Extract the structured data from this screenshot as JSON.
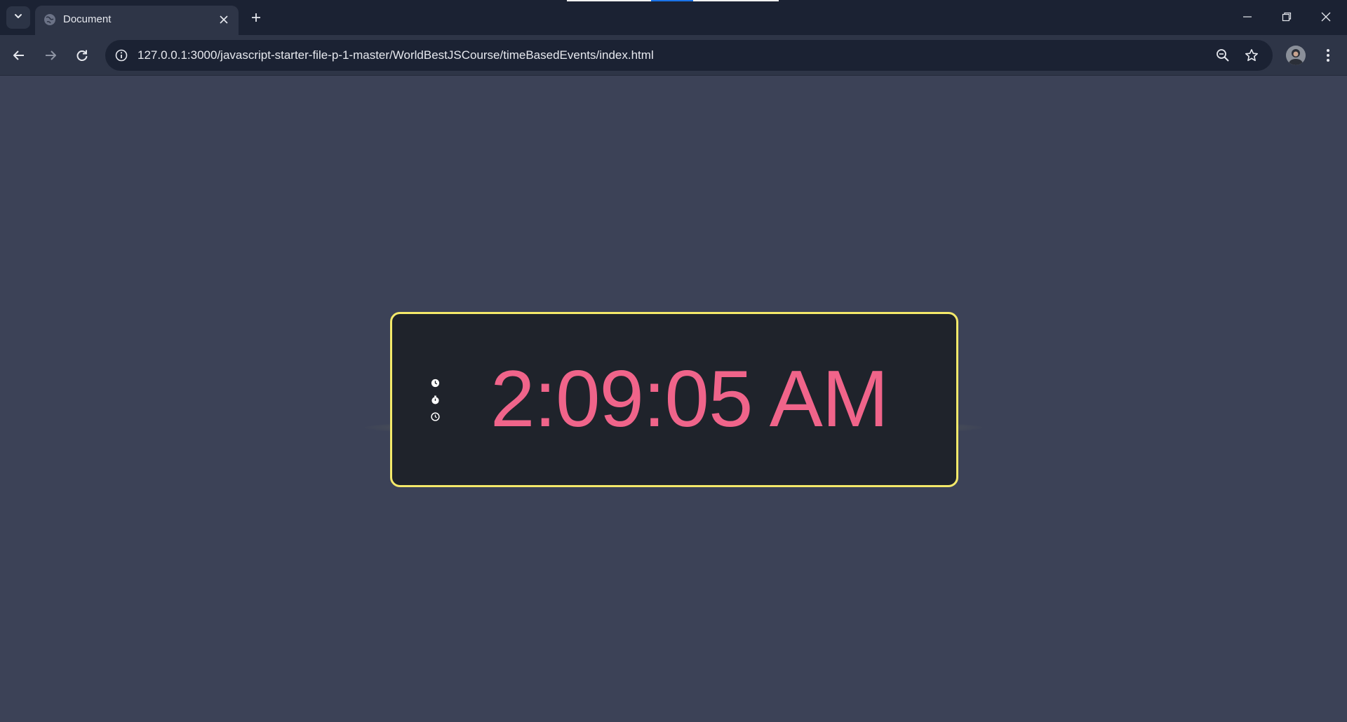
{
  "browser": {
    "tab": {
      "title": "Document",
      "favicon": "globe-icon"
    },
    "toolbar": {
      "url": "127.0.0.1:3000/javascript-starter-file-p-1-master/WorldBestJSCourse/timeBasedEvents/index.html"
    },
    "icons": {
      "tab_search": "chevron-down-icon",
      "close_tab": "close-icon",
      "new_tab": "plus-icon",
      "back": "arrow-left-icon",
      "forward": "arrow-right-icon",
      "reload": "reload-icon",
      "site_info": "info-icon",
      "zoom": "zoom-out-icon",
      "bookmark": "star-icon",
      "profile": "avatar",
      "menu": "kebab-menu-icon",
      "minimize": "minimize-icon",
      "restore": "restore-icon",
      "close_window": "close-icon"
    }
  },
  "page": {
    "clock": {
      "time": "2:09:05 AM",
      "mode_icons": [
        "clock-icon",
        "stopwatch-icon",
        "timer-icon"
      ]
    }
  },
  "colors": {
    "page_background": "#3c4257",
    "clock_background": "#1f232b",
    "clock_border": "#f4e96a",
    "time_text": "#f0648a",
    "browser_chrome": "#1b2233",
    "toolbar": "#2e3547"
  }
}
